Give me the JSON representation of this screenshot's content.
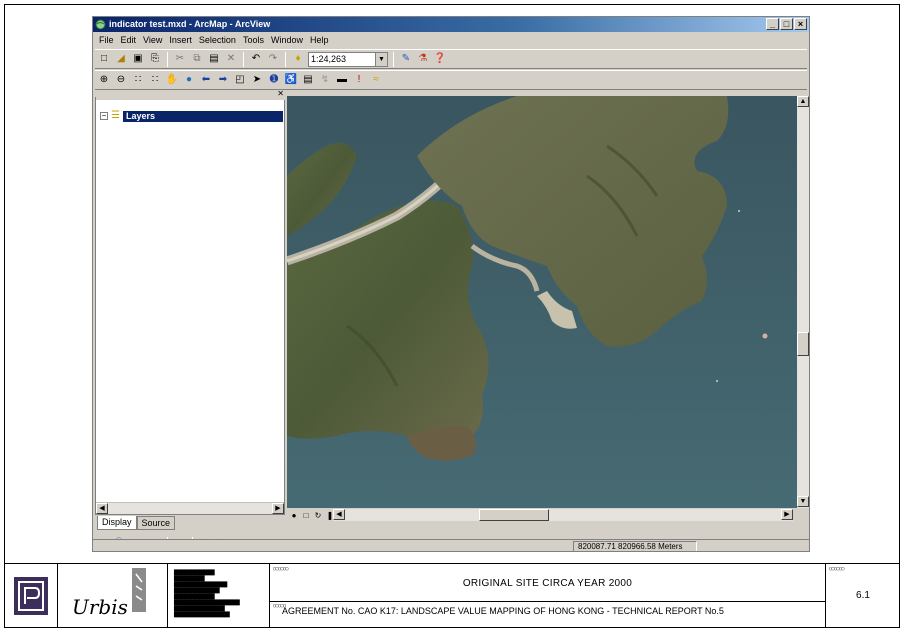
{
  "window": {
    "title": "indicator test.mxd - ArcMap - ArcView",
    "controls": [
      "_",
      "□",
      "×"
    ]
  },
  "menu": [
    "File",
    "Edit",
    "View",
    "Insert",
    "Selection",
    "Tools",
    "Window",
    "Help"
  ],
  "toolbar": {
    "scale_value": "1:24,263"
  },
  "toc": {
    "root_label": "Layers",
    "tabs": [
      "Display",
      "Source"
    ]
  },
  "status": {
    "coordinates": "820087.71  820966.58 Meters"
  },
  "title_block": {
    "figure_title": "ORIGINAL SITE CIRCA YEAR 2000",
    "report_line": "AGREEMENT No. CAO K17: LANDSCAPE VALUE MAPPING OF HONG KONG - TECHNICAL REPORT No.5",
    "figure_number": "6.1",
    "logo_text": "Urbis"
  },
  "colors": {
    "title_bar": "#0a246a",
    "window_face": "#d4d0c8",
    "sea": "#3d5a64",
    "land": "#4d5a3a"
  }
}
